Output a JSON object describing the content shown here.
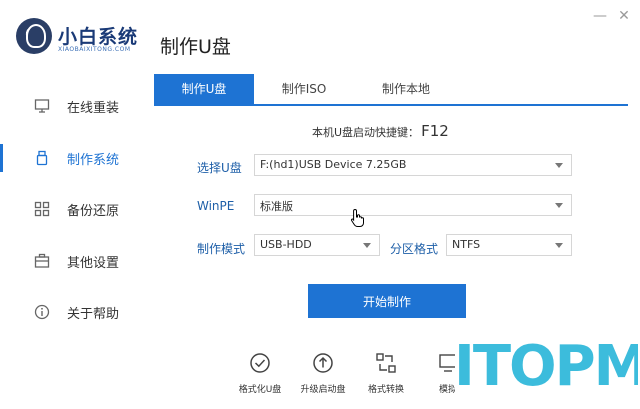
{
  "app": {
    "name": "小白系统",
    "subtitle": "XIAOBAIXITONG.COM",
    "page_title": "制作U盘"
  },
  "window": {
    "minimize": "—",
    "close": "✕"
  },
  "sidebar": {
    "items": [
      {
        "label": "在线重装",
        "icon": "monitor-icon"
      },
      {
        "label": "制作系统",
        "icon": "usb-icon",
        "active": true
      },
      {
        "label": "备份还原",
        "icon": "grid-icon"
      },
      {
        "label": "其他设置",
        "icon": "case-icon"
      },
      {
        "label": "关于帮助",
        "icon": "info-icon"
      }
    ]
  },
  "tabs": [
    {
      "label": "制作U盘",
      "active": true
    },
    {
      "label": "制作ISO"
    },
    {
      "label": "制作本地"
    }
  ],
  "hotkey": {
    "label": "本机U盘启动快捷键：",
    "key": "F12"
  },
  "form": {
    "select_usb": {
      "label": "选择U盘",
      "value": "F:(hd1)USB Device 7.25GB"
    },
    "winpe": {
      "label": "WinPE",
      "value": "标准版"
    },
    "mode": {
      "label": "制作模式",
      "value": "USB-HDD"
    },
    "partition": {
      "label": "分区格式",
      "value": "NTFS"
    }
  },
  "start_button": "开始制作",
  "tools": [
    {
      "label": "格式化U盘",
      "icon": "check-circle-icon"
    },
    {
      "label": "升级启动盘",
      "icon": "upload-circle-icon"
    },
    {
      "label": "格式转换",
      "icon": "convert-icon"
    },
    {
      "label": "模拟",
      "icon": "simulate-icon"
    }
  ],
  "watermark": "ITOPM",
  "colors": {
    "accent": "#1e73d3",
    "watermark": "#3cbcdc"
  }
}
